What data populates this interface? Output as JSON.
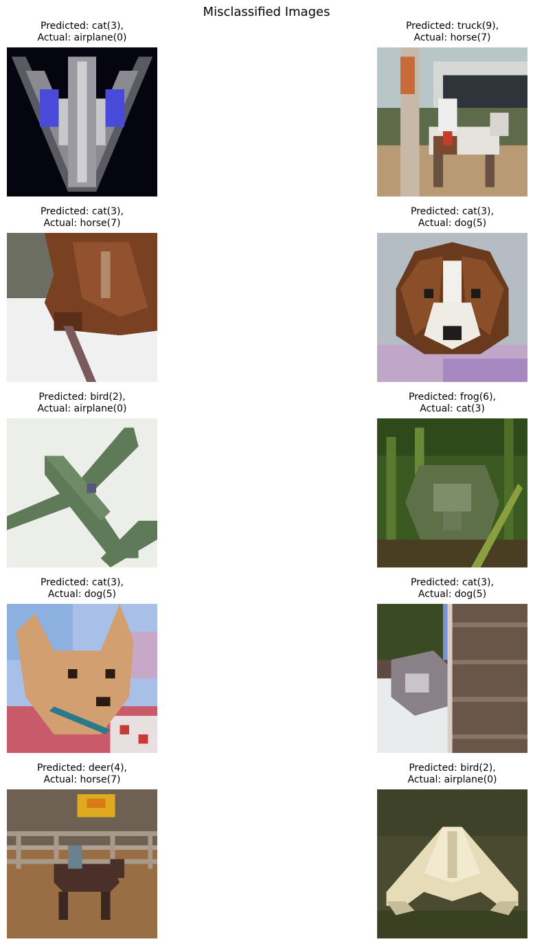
{
  "figure": {
    "title": "Misclassified Images"
  },
  "panels": [
    {
      "predicted": "Predicted: cat(3),",
      "actual": "Actual: airplane(0)",
      "image_icon": "airplane-image"
    },
    {
      "predicted": "Predicted: truck(9),",
      "actual": "Actual: horse(7)",
      "image_icon": "horse-rider-image"
    },
    {
      "predicted": "Predicted: cat(3),",
      "actual": "Actual: horse(7)",
      "image_icon": "horse-head-image"
    },
    {
      "predicted": "Predicted: cat(3),",
      "actual": "Actual: dog(5)",
      "image_icon": "dog-image"
    },
    {
      "predicted": "Predicted: bird(2),",
      "actual": "Actual: airplane(0)",
      "image_icon": "airplane-image"
    },
    {
      "predicted": "Predicted: frog(6),",
      "actual": "Actual: cat(3)",
      "image_icon": "cat-in-grass-image"
    },
    {
      "predicted": "Predicted: cat(3),",
      "actual": "Actual: dog(5)",
      "image_icon": "dog-image"
    },
    {
      "predicted": "Predicted: cat(3),",
      "actual": "Actual: dog(5)",
      "image_icon": "dog-behind-fence-image"
    },
    {
      "predicted": "Predicted: deer(4),",
      "actual": "Actual: horse(7)",
      "image_icon": "horse-arena-image"
    },
    {
      "predicted": "Predicted: bird(2),",
      "actual": "Actual: airplane(0)",
      "image_icon": "stealth-airplane-image"
    }
  ]
}
